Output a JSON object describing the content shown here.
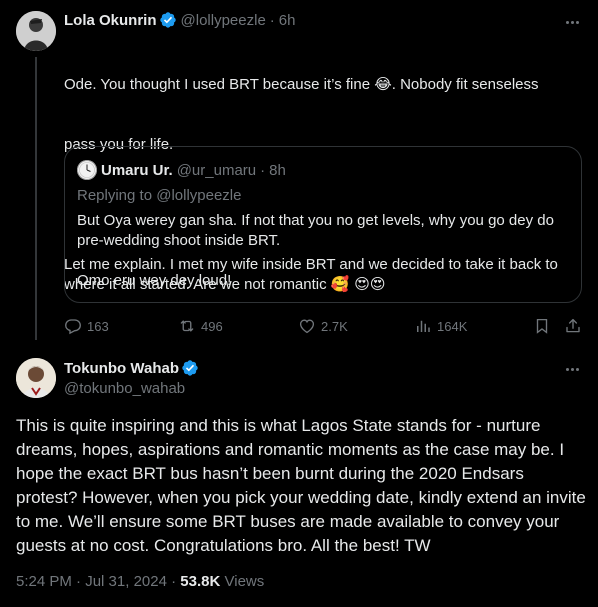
{
  "parent_tweet": {
    "author_name": "Lola Okunrin",
    "author_handle": "@lollypeezle",
    "separator": "·",
    "time": "6h",
    "text_line1": "Ode. You thought I used BRT because it’s fine ",
    "emoji_laugh": "😂",
    "text_line1b": ". Nobody fit senseless",
    "text_line2": "pass you for life.",
    "text_para2": "Let me explain. I met my wife inside BRT and we decided to take it back to where it all started. Are we not romantic ",
    "emoji_hearts": "🥰 😍😍",
    "avatar_icon": "person-silhouette-icon"
  },
  "quoted_tweet": {
    "author_name": "Umaru Ur.",
    "author_handle": "@ur_umaru",
    "separator": "·",
    "time": "8h",
    "replying_to": "Replying to @lollypeezle",
    "body": "But Oya werey gan sha. If not that you no get levels, why you go dey do pre-wedding shoot inside BRT.\n\nOmo eru wey dey loud!",
    "avatar_icon": "clock-face-icon"
  },
  "actions": {
    "replies": "163",
    "reposts": "496",
    "likes": "2.7K",
    "views": "164K"
  },
  "main_tweet": {
    "author_name": "Tokunbo Wahab",
    "author_handle": "@tokunbo_wahab",
    "text": "This is quite inspiring and this is what Lagos State stands for - nurture dreams, hopes, aspirations and romantic moments as the case may be. I hope the exact BRT bus hasn’t been burnt during the 2020 Endsars protest? However, when you pick your wedding date, kindly extend an invite to me. We’ll ensure some BRT buses are made available to convey your guests at no cost. Congratulations bro. All the best! TW",
    "time": "5:24 PM",
    "date": "Jul 31, 2024",
    "separator": "·",
    "views_count": "53.8K",
    "views_label": "Views"
  },
  "colors": {
    "background": "#000000",
    "text_primary": "#e7e9ea",
    "text_secondary": "#71767b",
    "verified_blue": "#1d9bf0",
    "border": "#2f3336"
  }
}
